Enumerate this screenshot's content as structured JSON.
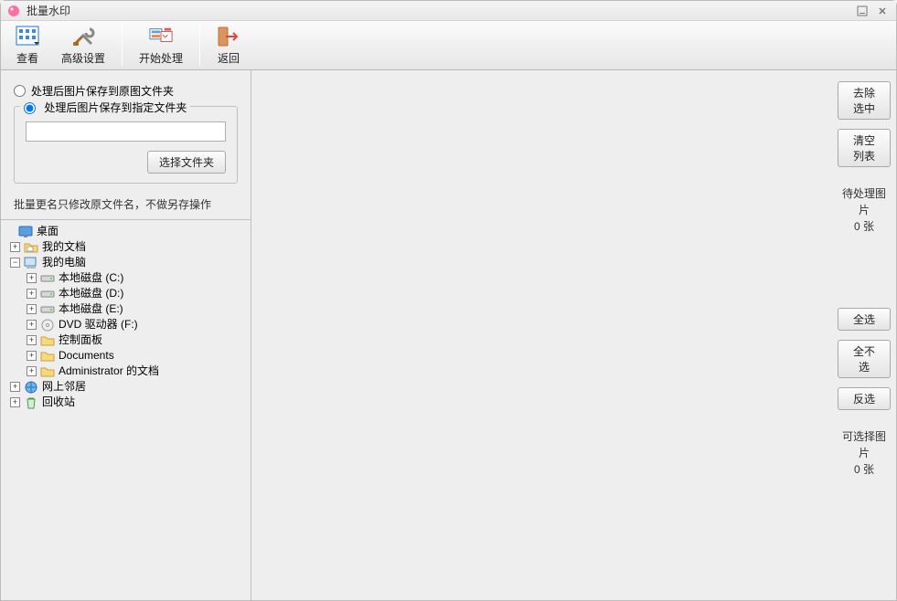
{
  "window": {
    "title": "批量水印"
  },
  "toolbar": {
    "view": "查看",
    "settings": "高级设置",
    "start": "开始处理",
    "back": "返回"
  },
  "options": {
    "save_to_original": "处理后图片保存到原图文件夹",
    "save_to_specified": "处理后图片保存到指定文件夹",
    "path_value": "",
    "choose_folder": "选择文件夹",
    "note": "批量更名只修改原文件名，不做另存操作"
  },
  "tree": {
    "desktop": "桌面",
    "my_docs": "我的文档",
    "my_computer": "我的电脑",
    "disk_c": "本地磁盘 (C:)",
    "disk_d": "本地磁盘 (D:)",
    "disk_e": "本地磁盘 (E:)",
    "dvd_f": "DVD 驱动器 (F:)",
    "control_panel": "控制面板",
    "documents": "Documents",
    "admin_docs": "Administrator 的文档",
    "network": "网上邻居",
    "recycle": "回收站"
  },
  "sidebar": {
    "remove_selected": "去除选中",
    "clear_list": "清空列表",
    "pending_label": "待处理图片",
    "pending_count": "0 张",
    "select_all": "全选",
    "select_none": "全不选",
    "invert": "反选",
    "selectable_label": "可选择图片",
    "selectable_count": "0 张"
  }
}
